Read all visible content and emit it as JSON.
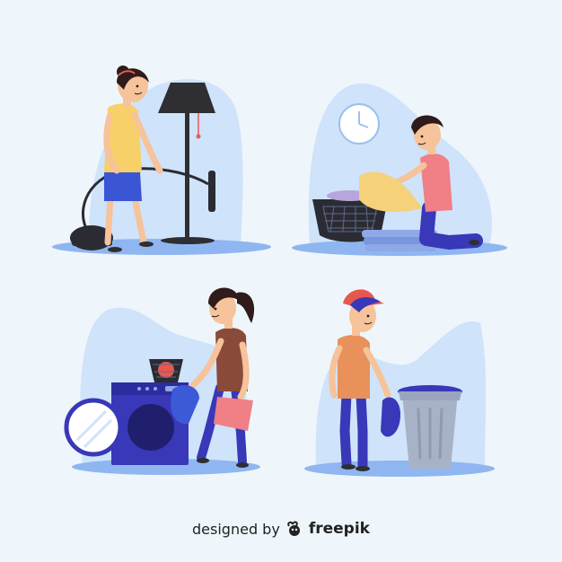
{
  "credit": {
    "prefix": "designed by",
    "brand": "freepik",
    "logo_icon": "freepik-logo-icon"
  },
  "palette": {
    "background": "#eef6fb",
    "blob": "#cfe3fb",
    "floor": "#8fb6f0",
    "skin": "#f6c39a",
    "hair": "#3a1f1a",
    "navy": "#3838b8",
    "lamp": "#2e2e33",
    "laundry_yellow": "#f5d17a",
    "shirt_pink": "#f07f86",
    "shirt_yellow": "#f8d06a",
    "shirt_brown": "#8a4a3a",
    "shirt_orange": "#e8915a",
    "cap_red": "#e8574c",
    "bin_gray": "#a8b2c6"
  },
  "scenes": [
    {
      "name": "vacuuming-scene"
    },
    {
      "name": "folding-laundry-scene"
    },
    {
      "name": "washing-machine-scene"
    },
    {
      "name": "taking-out-trash-scene"
    }
  ]
}
